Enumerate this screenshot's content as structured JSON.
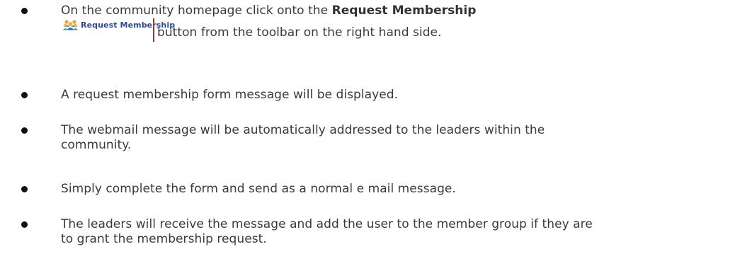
{
  "items": [
    {
      "prefix": "On the community homepage click onto the ",
      "bold": "Request Membership",
      "button_label": "Request Membership",
      "button_icon": "people-group-icon",
      "suffix": "button from the toolbar on the right hand side."
    },
    {
      "text": "A request membership form message will be displayed."
    },
    {
      "line1": "The webmail message will be automatically addressed to the leaders within the",
      "line2": "community."
    },
    {
      "text": "Simply complete the form and send as a normal e mail message."
    },
    {
      "line1": "The leaders will receive the message and add the user to the member group if they are",
      "line2": "to grant the membership request."
    }
  ],
  "colors": {
    "text": "#3a3a3a",
    "bullet": "#111111",
    "button_label": "#2b4c9b",
    "cursor": "#cc2222"
  }
}
